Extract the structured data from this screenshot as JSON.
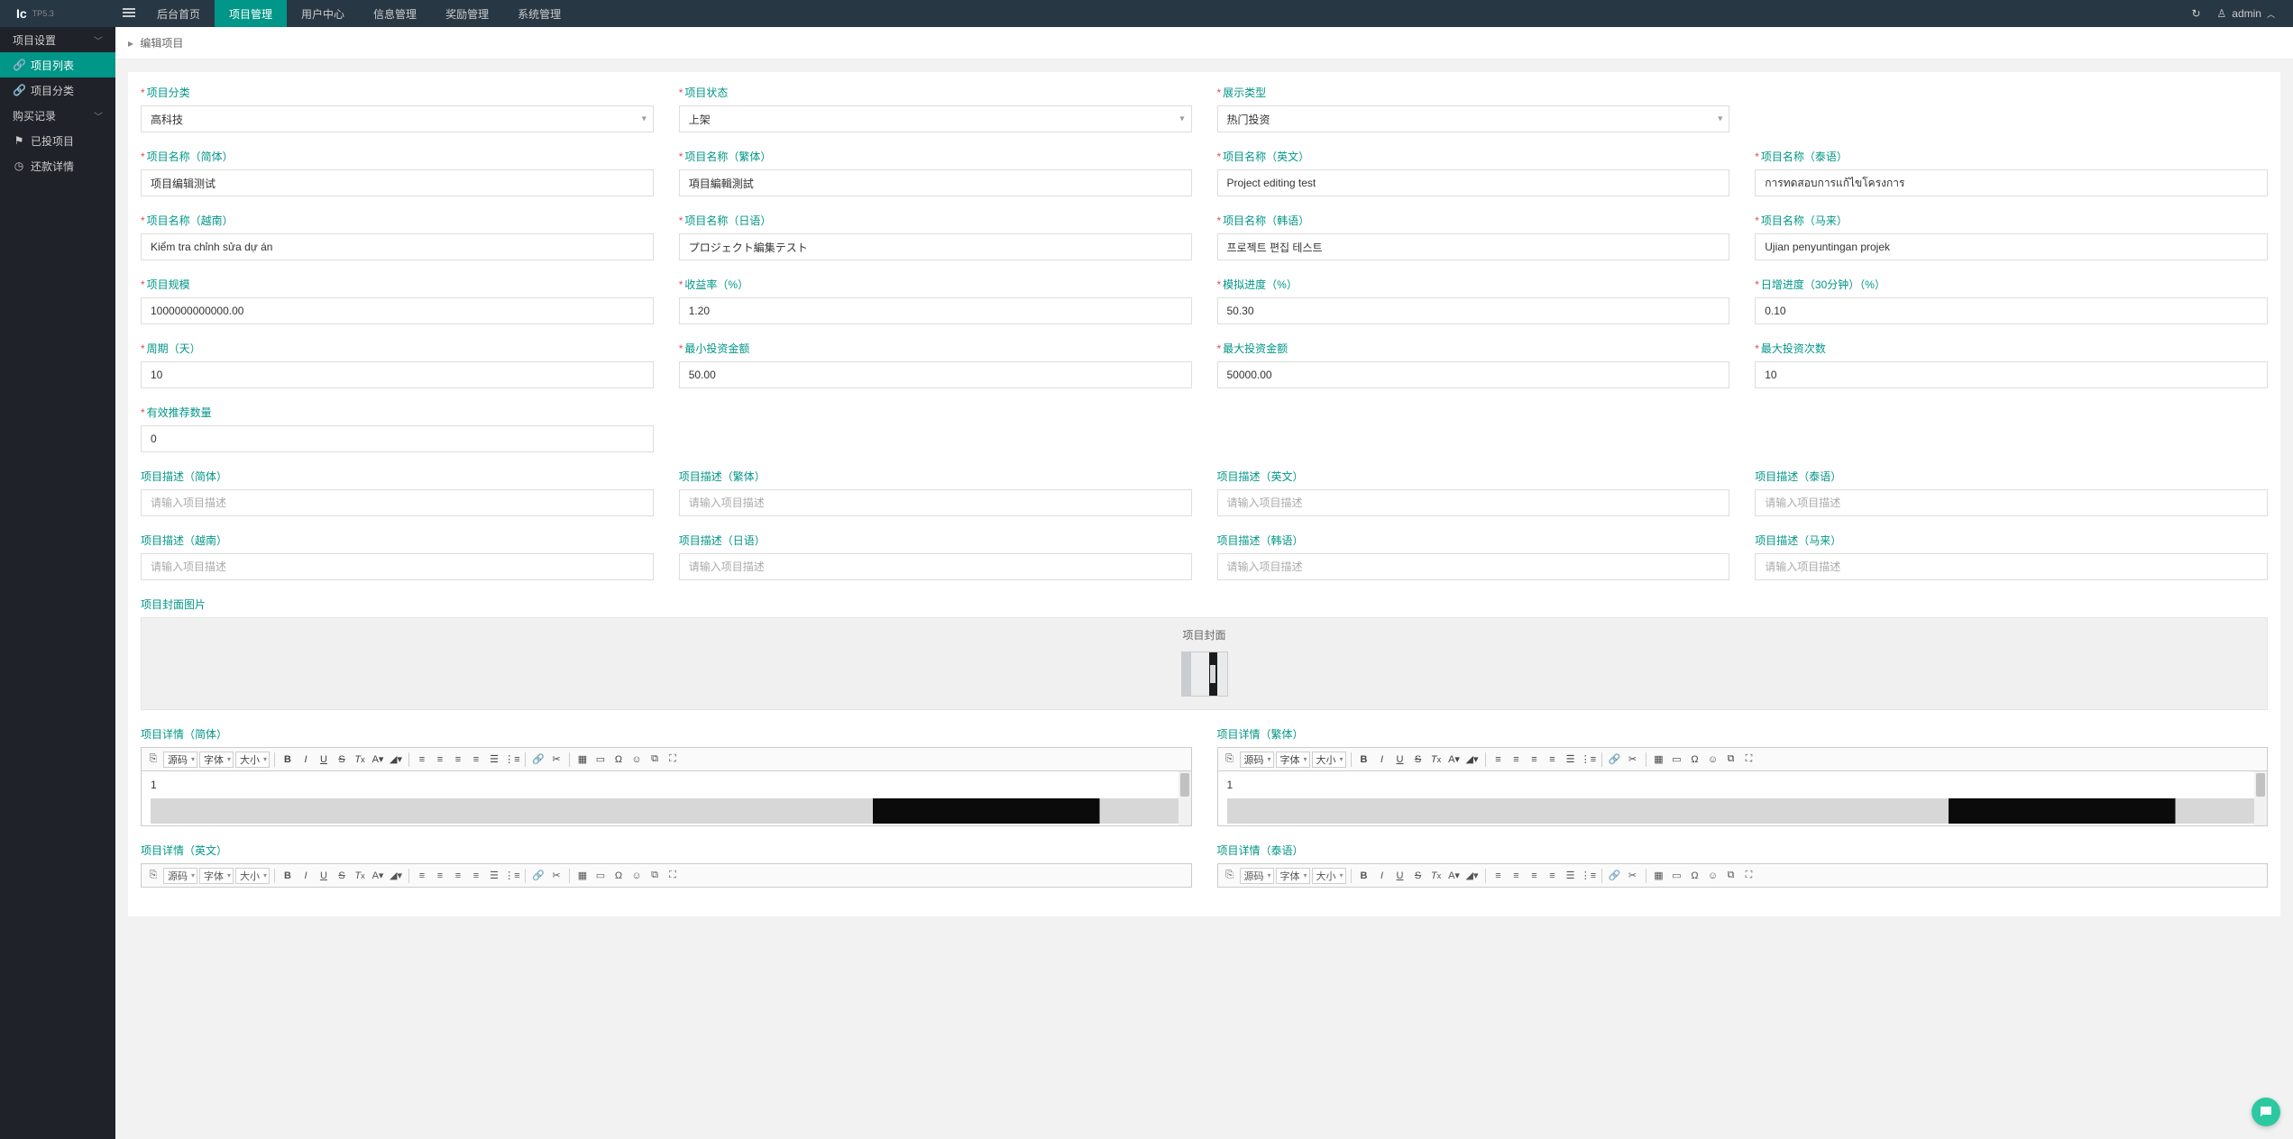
{
  "logo": {
    "brand": "Ic",
    "sub": "TP5.3"
  },
  "topnav": [
    {
      "label": "后台首页"
    },
    {
      "label": "项目管理",
      "active": true
    },
    {
      "label": "用户中心"
    },
    {
      "label": "信息管理"
    },
    {
      "label": "奖励管理"
    },
    {
      "label": "系统管理"
    }
  ],
  "user": {
    "name": "admin"
  },
  "sidebar": {
    "groups": [
      {
        "label": "项目设置",
        "chev": true
      },
      {
        "label": "项目列表",
        "icon": "link",
        "active": true
      },
      {
        "label": "项目分类",
        "icon": "link"
      },
      {
        "label": "购买记录",
        "chev": true
      },
      {
        "label": "已投项目",
        "icon": "flag"
      },
      {
        "label": "还款详情",
        "icon": "clock"
      }
    ]
  },
  "breadcrumb": {
    "title": "编辑项目"
  },
  "fields": {
    "category": {
      "label": "项目分类",
      "value": "高科技"
    },
    "status": {
      "label": "项目状态",
      "value": "上架"
    },
    "display_type": {
      "label": "展示类型",
      "value": "热门投资"
    },
    "name_sc": {
      "label": "项目名称（简体）",
      "value": "项目编辑测试"
    },
    "name_tc": {
      "label": "项目名称（繁体）",
      "value": "項目編輯測試"
    },
    "name_en": {
      "label": "项目名称（英文）",
      "value": "Project editing test"
    },
    "name_th": {
      "label": "项目名称（泰语）",
      "value": "การทดสอบการแก้ไขโครงการ"
    },
    "name_vi": {
      "label": "项目名称（越南）",
      "value": "Kiểm tra chỉnh sửa dự án"
    },
    "name_ja": {
      "label": "项目名称（日语）",
      "value": "プロジェクト編集テスト"
    },
    "name_ko": {
      "label": "项目名称（韩语）",
      "value": "프로젝트 편집 테스트"
    },
    "name_ms": {
      "label": "项目名称（马来）",
      "value": "Ujian penyuntingan projek"
    },
    "scale": {
      "label": "项目规模",
      "value": "1000000000000.00"
    },
    "yield": {
      "label": "收益率（%）",
      "value": "1.20"
    },
    "mock_progress": {
      "label": "模拟进度（%）",
      "value": "50.30"
    },
    "growth": {
      "label": "日增进度（30分钟）（%）",
      "value": "0.10"
    },
    "period": {
      "label": "周期（天）",
      "value": "10"
    },
    "min_invest": {
      "label": "最小投资金额",
      "value": "50.00"
    },
    "max_invest": {
      "label": "最大投资金额",
      "value": "50000.00"
    },
    "max_times": {
      "label": "最大投资次数",
      "value": "10"
    },
    "rec_count": {
      "label": "有效推荐数量",
      "value": "0"
    },
    "desc_sc": {
      "label": "项目描述（简体）",
      "placeholder": "请输入项目描述"
    },
    "desc_tc": {
      "label": "项目描述（繁体）",
      "placeholder": "请输入项目描述"
    },
    "desc_en": {
      "label": "项目描述（英文）",
      "placeholder": "请输入项目描述"
    },
    "desc_th": {
      "label": "项目描述（泰语）",
      "placeholder": "请输入项目描述"
    },
    "desc_vi": {
      "label": "项目描述（越南）",
      "placeholder": "请输入项目描述"
    },
    "desc_ja": {
      "label": "项目描述（日语）",
      "placeholder": "请输入项目描述"
    },
    "desc_ko": {
      "label": "项目描述（韩语）",
      "placeholder": "请输入项目描述"
    },
    "desc_ms": {
      "label": "项目描述（马来）",
      "placeholder": "请输入项目描述"
    },
    "cover": {
      "label": "项目封面图片",
      "title": "项目封面"
    },
    "detail_sc": {
      "label": "项目详情（简体）",
      "content": "1"
    },
    "detail_tc": {
      "label": "项目详情（繁体）",
      "content": "1"
    },
    "detail_en": {
      "label": "项目详情（英文）"
    },
    "detail_th": {
      "label": "项目详情（泰语）"
    }
  },
  "editor_toolbar": {
    "source": "源码",
    "font": "字体",
    "size": "大小"
  }
}
